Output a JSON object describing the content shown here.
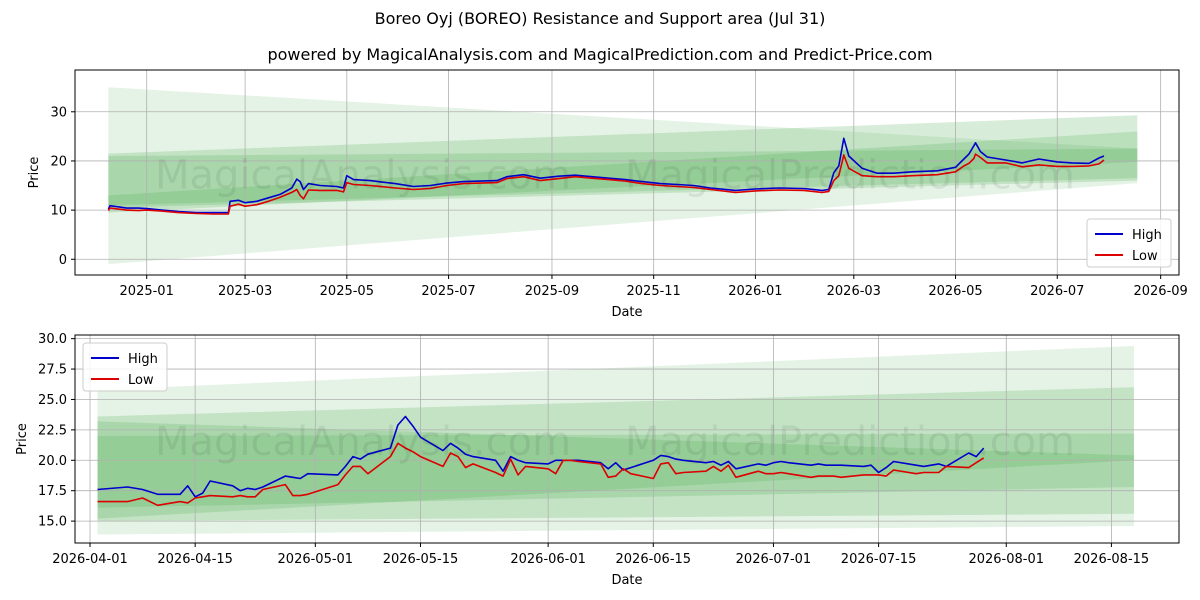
{
  "title": "Boreo Oyj (BOREO) Resistance and Support area (Jul 31)",
  "subtitle": "powered by MagicalAnalysis.com and MagicalPrediction.com and Predict-Price.com",
  "watermarks": [
    "MagicalAnalysis.com",
    "MagicalPrediction.com"
  ],
  "colors": {
    "high": "#0000cc",
    "low": "#dd0000",
    "band": "#4caf50",
    "grid": "#b0b0b0"
  },
  "chart_data": [
    {
      "type": "line",
      "xlabel": "Date",
      "ylabel": "Price",
      "xlim": [
        "2024-11-19",
        "2026-09-12"
      ],
      "ylim": [
        -3.2,
        38.5
      ],
      "xticks": [
        "2025-01-01",
        "2025-03-01",
        "2025-05-01",
        "2025-07-01",
        "2025-09-01",
        "2025-11-01",
        "2026-01-01",
        "2026-03-01",
        "2026-05-01",
        "2026-07-01",
        "2026-09-01"
      ],
      "xticklabels": [
        "2025-01",
        "2025-03",
        "2025-05",
        "2025-07",
        "2025-09",
        "2025-11",
        "2026-01",
        "2026-03",
        "2026-05",
        "2026-07",
        "2026-09"
      ],
      "yticks": [
        0,
        10,
        20,
        30
      ],
      "yticklabels": [
        "0",
        "10",
        "20",
        "30"
      ],
      "grid": true,
      "legend": "bottom-right",
      "bands": [
        {
          "x": [
            "2024-12-09",
            "2026-08-18"
          ],
          "lower": [
            -1.0,
            15.5
          ],
          "upper": [
            35.0,
            22.5
          ]
        },
        {
          "x": [
            "2024-12-09",
            "2026-08-18"
          ],
          "lower": [
            9.5,
            19.8
          ],
          "upper": [
            21.5,
            29.3
          ]
        },
        {
          "x": [
            "2024-12-09",
            "2026-08-18"
          ],
          "lower": [
            10.5,
            16.0
          ],
          "upper": [
            13.0,
            26.0
          ]
        },
        {
          "x": [
            "2024-12-09",
            "2026-08-18"
          ],
          "lower": [
            11.0,
            16.5
          ],
          "upper": [
            21.0,
            22.5
          ]
        }
      ],
      "series": [
        {
          "name": "High",
          "x": [
            "2024-12-09",
            "2024-12-10",
            "2024-12-20",
            "2024-12-27",
            "2025-01-01",
            "2025-01-10",
            "2025-01-20",
            "2025-01-31",
            "2025-02-10",
            "2025-02-19",
            "2025-02-20",
            "2025-02-25",
            "2025-03-01",
            "2025-03-08",
            "2025-03-15",
            "2025-03-22",
            "2025-03-29",
            "2025-04-01",
            "2025-04-03",
            "2025-04-05",
            "2025-04-08",
            "2025-04-15",
            "2025-04-25",
            "2025-04-29",
            "2025-05-01",
            "2025-05-05",
            "2025-05-15",
            "2025-05-30",
            "2025-06-10",
            "2025-06-20",
            "2025-06-30",
            "2025-07-10",
            "2025-07-20",
            "2025-07-30",
            "2025-08-05",
            "2025-08-15",
            "2025-08-25",
            "2025-09-05",
            "2025-09-15",
            "2025-09-25",
            "2025-10-05",
            "2025-10-15",
            "2025-10-25",
            "2025-11-05",
            "2025-11-15",
            "2025-11-25",
            "2025-12-05",
            "2025-12-20",
            "2026-01-01",
            "2026-01-15",
            "2026-01-30",
            "2026-02-10",
            "2026-02-14",
            "2026-02-17",
            "2026-02-20",
            "2026-02-23",
            "2026-02-26",
            "2026-03-06",
            "2026-03-15",
            "2026-03-25",
            "2026-04-05",
            "2026-04-20",
            "2026-05-01",
            "2026-05-06",
            "2026-05-09",
            "2026-05-12",
            "2026-05-13",
            "2026-05-16",
            "2026-05-20",
            "2026-05-31",
            "2026-06-10",
            "2026-06-20",
            "2026-07-01",
            "2026-07-10",
            "2026-07-20",
            "2026-07-26",
            "2026-07-29"
          ],
          "y": [
            10.2,
            10.9,
            10.4,
            10.4,
            10.3,
            10.0,
            9.7,
            9.5,
            9.5,
            9.5,
            11.8,
            12.0,
            11.5,
            11.8,
            12.5,
            13.2,
            14.5,
            16.3,
            15.8,
            14.2,
            15.4,
            15.0,
            14.8,
            14.5,
            17.0,
            16.2,
            16.0,
            15.4,
            14.8,
            15.0,
            15.5,
            15.8,
            15.9,
            16.0,
            16.8,
            17.2,
            16.5,
            16.9,
            17.1,
            16.8,
            16.5,
            16.2,
            15.8,
            15.4,
            15.2,
            15.0,
            14.5,
            14.0,
            14.3,
            14.5,
            14.4,
            14.0,
            14.2,
            17.6,
            19.0,
            24.6,
            21.0,
            18.5,
            17.5,
            17.5,
            17.8,
            18.0,
            18.7,
            20.4,
            21.4,
            23.1,
            23.7,
            21.9,
            20.8,
            20.2,
            19.6,
            20.4,
            19.8,
            19.6,
            19.5,
            20.6,
            21.0
          ]
        },
        {
          "name": "Low",
          "x": [
            "2024-12-09",
            "2024-12-10",
            "2024-12-20",
            "2024-12-27",
            "2025-01-01",
            "2025-01-10",
            "2025-01-20",
            "2025-01-31",
            "2025-02-10",
            "2025-02-19",
            "2025-02-20",
            "2025-02-25",
            "2025-03-01",
            "2025-03-08",
            "2025-03-15",
            "2025-03-22",
            "2025-03-29",
            "2025-04-01",
            "2025-04-03",
            "2025-04-05",
            "2025-04-08",
            "2025-04-15",
            "2025-04-25",
            "2025-04-29",
            "2025-05-01",
            "2025-05-05",
            "2025-05-15",
            "2025-05-30",
            "2025-06-10",
            "2025-06-20",
            "2025-06-30",
            "2025-07-10",
            "2025-07-20",
            "2025-07-30",
            "2025-08-05",
            "2025-08-15",
            "2025-08-25",
            "2025-09-05",
            "2025-09-15",
            "2025-09-25",
            "2025-10-05",
            "2025-10-15",
            "2025-10-25",
            "2025-11-05",
            "2025-11-15",
            "2025-11-25",
            "2025-12-05",
            "2025-12-20",
            "2026-01-01",
            "2026-01-15",
            "2026-01-30",
            "2026-02-10",
            "2026-02-14",
            "2026-02-17",
            "2026-02-20",
            "2026-02-23",
            "2026-02-26",
            "2026-03-06",
            "2026-03-15",
            "2026-03-25",
            "2026-04-05",
            "2026-04-20",
            "2026-05-01",
            "2026-05-06",
            "2026-05-09",
            "2026-05-12",
            "2026-05-13",
            "2026-05-16",
            "2026-05-20",
            "2026-05-31",
            "2026-06-10",
            "2026-06-20",
            "2026-07-01",
            "2026-07-10",
            "2026-07-20",
            "2026-07-26",
            "2026-07-29"
          ],
          "y": [
            9.9,
            10.4,
            10.0,
            9.9,
            10.0,
            9.8,
            9.5,
            9.3,
            9.2,
            9.2,
            10.8,
            11.2,
            10.8,
            11.1,
            11.8,
            12.6,
            13.6,
            14.2,
            13.0,
            12.3,
            14.1,
            14.0,
            14.0,
            13.7,
            15.6,
            15.2,
            15.0,
            14.5,
            14.2,
            14.4,
            15.0,
            15.4,
            15.5,
            15.6,
            16.4,
            16.8,
            16.0,
            16.4,
            16.8,
            16.5,
            16.2,
            15.9,
            15.4,
            15.0,
            14.8,
            14.6,
            14.2,
            13.6,
            13.9,
            14.1,
            14.0,
            13.6,
            13.8,
            16.0,
            17.0,
            21.2,
            18.5,
            17.0,
            16.8,
            16.8,
            17.0,
            17.2,
            17.8,
            19.0,
            19.5,
            20.5,
            21.4,
            20.7,
            19.6,
            19.6,
            18.8,
            19.2,
            18.9,
            18.9,
            19.0,
            19.4,
            20.2
          ]
        }
      ]
    },
    {
      "type": "line",
      "xlabel": "Date",
      "ylabel": "Price",
      "xlim": [
        "2026-03-30",
        "2026-08-24"
      ],
      "ylim": [
        13.2,
        30.3
      ],
      "xticks": [
        "2026-04-01",
        "2026-04-15",
        "2026-05-01",
        "2026-05-15",
        "2026-06-01",
        "2026-06-15",
        "2026-07-01",
        "2026-07-15",
        "2026-08-01",
        "2026-08-15"
      ],
      "xticklabels": [
        "2026-04-01",
        "2026-04-15",
        "2026-05-01",
        "2026-05-15",
        "2026-06-01",
        "2026-06-15",
        "2026-07-01",
        "2026-07-15",
        "2026-08-01",
        "2026-08-15"
      ],
      "yticks": [
        15.0,
        17.5,
        20.0,
        22.5,
        25.0,
        27.5,
        30.0
      ],
      "yticklabels": [
        "15.0",
        "17.5",
        "20.0",
        "22.5",
        "25.0",
        "27.5",
        "30.0"
      ],
      "grid": true,
      "legend": "top-left",
      "bands": [
        {
          "x": [
            "2026-04-02",
            "2026-08-18"
          ],
          "lower": [
            13.9,
            14.6
          ],
          "upper": [
            25.8,
            29.4
          ]
        },
        {
          "x": [
            "2026-04-02",
            "2026-08-18"
          ],
          "lower": [
            15.0,
            15.6
          ],
          "upper": [
            23.6,
            26.0
          ]
        },
        {
          "x": [
            "2026-04-02",
            "2026-08-18"
          ],
          "lower": [
            15.2,
            20.0
          ],
          "upper": [
            23.2,
            20.4
          ]
        },
        {
          "x": [
            "2026-04-02",
            "2026-08-18"
          ],
          "lower": [
            16.1,
            17.8
          ],
          "upper": [
            22.0,
            22.2
          ]
        }
      ],
      "series": [
        {
          "name": "High",
          "x": [
            "2026-04-02",
            "2026-04-06",
            "2026-04-08",
            "2026-04-10",
            "2026-04-13",
            "2026-04-14",
            "2026-04-15",
            "2026-04-16",
            "2026-04-17",
            "2026-04-20",
            "2026-04-21",
            "2026-04-22",
            "2026-04-23",
            "2026-04-24",
            "2026-04-27",
            "2026-04-28",
            "2026-04-29",
            "2026-04-30",
            "2026-05-04",
            "2026-05-05",
            "2026-05-06",
            "2026-05-07",
            "2026-05-08",
            "2026-05-11",
            "2026-05-12",
            "2026-05-13",
            "2026-05-14",
            "2026-05-15",
            "2026-05-18",
            "2026-05-19",
            "2026-05-20",
            "2026-05-21",
            "2026-05-22",
            "2026-05-25",
            "2026-05-26",
            "2026-05-27",
            "2026-05-28",
            "2026-05-29",
            "2026-06-01",
            "2026-06-02",
            "2026-06-03",
            "2026-06-04",
            "2026-06-05",
            "2026-06-08",
            "2026-06-09",
            "2026-06-10",
            "2026-06-11",
            "2026-06-12",
            "2026-06-15",
            "2026-06-16",
            "2026-06-17",
            "2026-06-18",
            "2026-06-19",
            "2026-06-22",
            "2026-06-23",
            "2026-06-24",
            "2026-06-25",
            "2026-06-26",
            "2026-06-29",
            "2026-06-30",
            "2026-07-01",
            "2026-07-02",
            "2026-07-03",
            "2026-07-06",
            "2026-07-07",
            "2026-07-08",
            "2026-07-09",
            "2026-07-10",
            "2026-07-13",
            "2026-07-14",
            "2026-07-15",
            "2026-07-16",
            "2026-07-17",
            "2026-07-20",
            "2026-07-21",
            "2026-07-22",
            "2026-07-23",
            "2026-07-24",
            "2026-07-27",
            "2026-07-28",
            "2026-07-29"
          ],
          "y": [
            17.6,
            17.8,
            17.6,
            17.2,
            17.2,
            17.9,
            17.0,
            17.3,
            18.3,
            17.9,
            17.5,
            17.7,
            17.6,
            17.8,
            18.7,
            18.6,
            18.5,
            18.9,
            18.8,
            19.5,
            20.3,
            20.1,
            20.5,
            21.0,
            22.9,
            23.6,
            22.8,
            21.9,
            20.8,
            21.4,
            21.0,
            20.5,
            20.3,
            20.0,
            19.1,
            20.3,
            20.0,
            19.8,
            19.7,
            20.0,
            20.0,
            20.0,
            20.0,
            19.8,
            19.3,
            19.8,
            19.2,
            19.4,
            20.0,
            20.4,
            20.3,
            20.1,
            20.0,
            19.8,
            19.9,
            19.6,
            19.9,
            19.3,
            19.7,
            19.6,
            19.8,
            19.9,
            19.8,
            19.6,
            19.7,
            19.6,
            19.6,
            19.6,
            19.5,
            19.6,
            19.0,
            19.4,
            19.9,
            19.6,
            19.5,
            19.6,
            19.7,
            19.5,
            20.6,
            20.3,
            21.0
          ]
        },
        {
          "name": "Low",
          "x": [
            "2026-04-02",
            "2026-04-06",
            "2026-04-08",
            "2026-04-10",
            "2026-04-13",
            "2026-04-14",
            "2026-04-15",
            "2026-04-16",
            "2026-04-17",
            "2026-04-20",
            "2026-04-21",
            "2026-04-22",
            "2026-04-23",
            "2026-04-24",
            "2026-04-27",
            "2026-04-28",
            "2026-04-29",
            "2026-04-30",
            "2026-05-04",
            "2026-05-05",
            "2026-05-06",
            "2026-05-07",
            "2026-05-08",
            "2026-05-11",
            "2026-05-12",
            "2026-05-13",
            "2026-05-14",
            "2026-05-15",
            "2026-05-18",
            "2026-05-19",
            "2026-05-20",
            "2026-05-21",
            "2026-05-22",
            "2026-05-25",
            "2026-05-26",
            "2026-05-27",
            "2026-05-28",
            "2026-05-29",
            "2026-06-01",
            "2026-06-02",
            "2026-06-03",
            "2026-06-04",
            "2026-06-05",
            "2026-06-08",
            "2026-06-09",
            "2026-06-10",
            "2026-06-11",
            "2026-06-12",
            "2026-06-15",
            "2026-06-16",
            "2026-06-17",
            "2026-06-18",
            "2026-06-19",
            "2026-06-22",
            "2026-06-23",
            "2026-06-24",
            "2026-06-25",
            "2026-06-26",
            "2026-06-29",
            "2026-06-30",
            "2026-07-01",
            "2026-07-02",
            "2026-07-03",
            "2026-07-06",
            "2026-07-07",
            "2026-07-08",
            "2026-07-09",
            "2026-07-10",
            "2026-07-13",
            "2026-07-14",
            "2026-07-15",
            "2026-07-16",
            "2026-07-17",
            "2026-07-20",
            "2026-07-21",
            "2026-07-22",
            "2026-07-23",
            "2026-07-24",
            "2026-07-27",
            "2026-07-28",
            "2026-07-29"
          ],
          "y": [
            16.6,
            16.6,
            16.9,
            16.3,
            16.6,
            16.5,
            16.9,
            17.0,
            17.1,
            17.0,
            17.1,
            17.0,
            17.0,
            17.6,
            18.0,
            17.1,
            17.1,
            17.2,
            18.0,
            18.8,
            19.5,
            19.5,
            18.9,
            20.3,
            21.4,
            21.0,
            20.7,
            20.3,
            19.5,
            20.6,
            20.3,
            19.4,
            19.7,
            19.0,
            18.7,
            20.1,
            18.8,
            19.5,
            19.3,
            18.9,
            20.0,
            20.0,
            19.9,
            19.7,
            18.6,
            18.7,
            19.3,
            18.9,
            18.5,
            19.7,
            19.8,
            18.9,
            19.0,
            19.1,
            19.5,
            19.1,
            19.6,
            18.6,
            19.1,
            18.9,
            18.9,
            19.0,
            18.9,
            18.6,
            18.7,
            18.7,
            18.7,
            18.6,
            18.8,
            18.8,
            18.8,
            18.7,
            19.2,
            18.9,
            19.0,
            19.0,
            19.0,
            19.5,
            19.4,
            19.8,
            20.2
          ]
        }
      ]
    }
  ]
}
